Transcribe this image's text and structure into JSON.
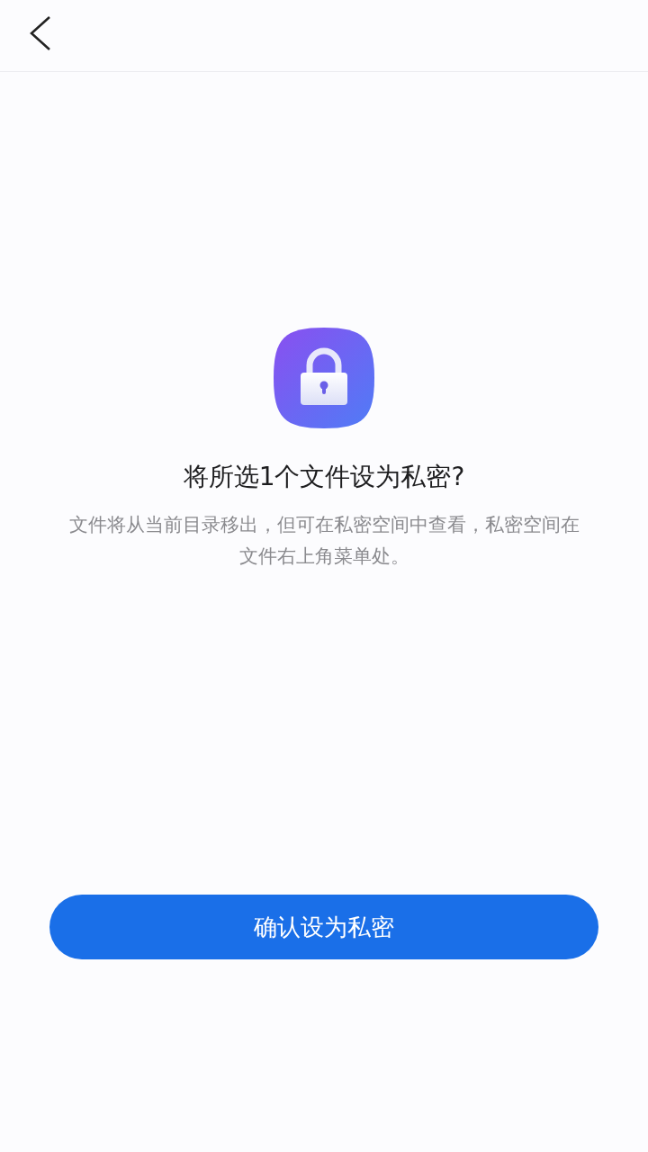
{
  "header": {
    "back": true
  },
  "dialog": {
    "title": "将所选1个文件设为私密?",
    "description": "文件将从当前目录移出，但可在私密空间中查看，私密空间在文件右上角菜单处。"
  },
  "confirm_button": {
    "label": "确认设为私密"
  }
}
